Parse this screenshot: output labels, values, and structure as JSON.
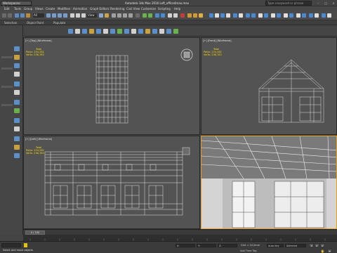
{
  "titlebar": {
    "workspace": "Workspaces: Default",
    "title": "Autodesk 3ds Max 2016    Loft_office4max.max",
    "search_placeholder": "Type a keyword or phrase"
  },
  "menubar": {
    "items": [
      "Edit",
      "Tools",
      "Group",
      "Views",
      "Create",
      "Modifiers",
      "Animation",
      "Graph Editors",
      "Rendering",
      "Civil View",
      "Customize",
      "Scripting",
      "Help"
    ]
  },
  "toolbar": {
    "filter": "All",
    "view_dropdown": "View"
  },
  "ribbon": {
    "tabs": [
      "Selection",
      "Object Paint",
      "Populate"
    ]
  },
  "viewports": {
    "top": {
      "label": "[+] [Top] [Wireframe]",
      "stats": {
        "heading": "Total",
        "polys_label": "Polys:",
        "polys": "234,282",
        "verts_label": "Verts:",
        "verts": "236,783"
      }
    },
    "front": {
      "label": "[+] [Front] [Wireframe]",
      "stats": {
        "heading": "Total",
        "polys_label": "Polys:",
        "polys": "234,282",
        "verts_label": "Verts:",
        "verts": "236,783"
      }
    },
    "left": {
      "label": "[+] [Left] [Wireframe]",
      "stats": {
        "heading": "Total",
        "polys_label": "Polys:",
        "polys": "234,282",
        "verts_label": "Verts:",
        "verts": "236,783"
      }
    },
    "camera": {
      "label": ""
    }
  },
  "timeline": {
    "frame": "0 / 100"
  },
  "statusbar": {
    "message": "Select and move objects",
    "x_label": "X:",
    "y_label": "Y:",
    "z_label": "Z:",
    "grid": "Grid = 10,0mm",
    "add_time_tag": "Add Time Tag",
    "auto_key": "Auto Key",
    "selected": "Selected"
  },
  "colors": {
    "viewport_bg": "#535353",
    "active_border": "#e0a020",
    "stats_text": "#ffdd00",
    "wire": "#dcdcdc"
  }
}
